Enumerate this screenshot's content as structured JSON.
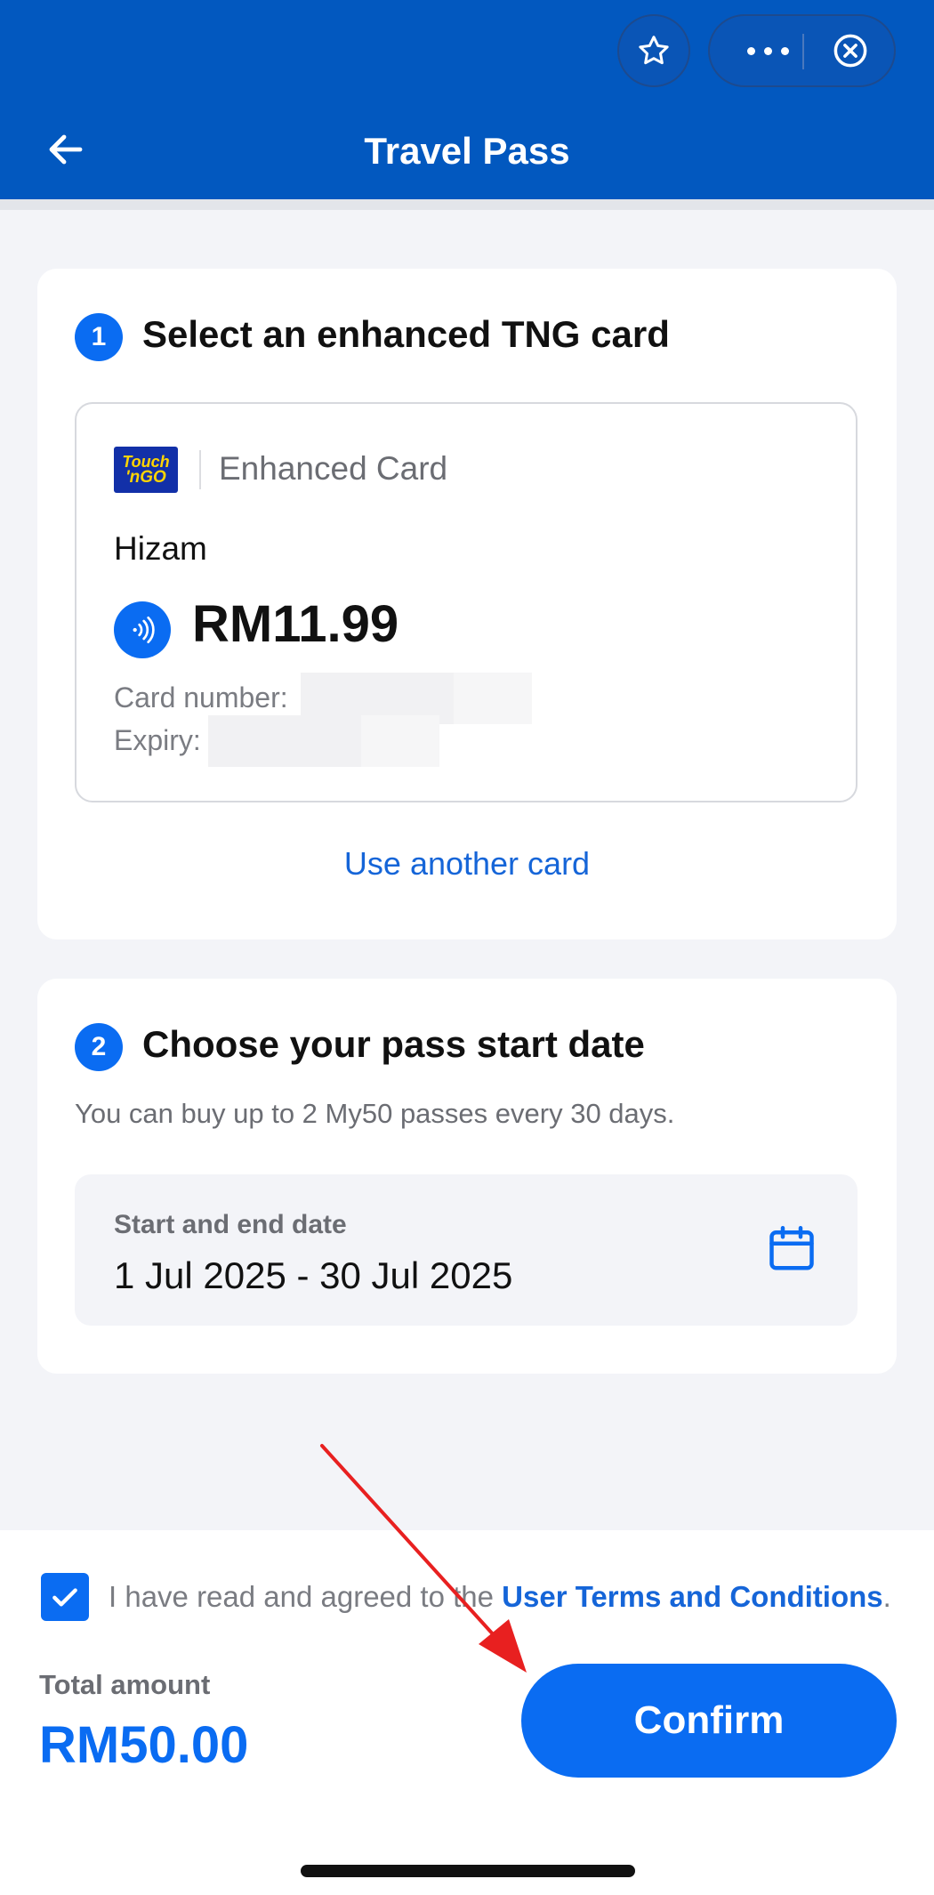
{
  "header": {
    "title": "Travel Pass",
    "icons": [
      "back-arrow-icon",
      "star-icon",
      "more-dots-icon",
      "close-circle-icon"
    ],
    "color": "#0258bf"
  },
  "step1": {
    "number": "1",
    "title": "Select an enhanced TNG card",
    "card": {
      "logo_line1": "Touch",
      "logo_line2": "'nGO",
      "type": "Enhanced Card",
      "name": "Hizam",
      "balance": "RM11.99",
      "card_number_label": "Card number:",
      "expiry_label": "Expiry:"
    },
    "use_another": "Use another card"
  },
  "step2": {
    "number": "2",
    "title": "Choose your pass start date",
    "limit_text": "You can buy up to 2 My50 passes every 30 days.",
    "date_label": "Start and end date",
    "date_value": "1 Jul 2025 - 30 Jul 2025"
  },
  "footer": {
    "agree_prefix": "I have read and agreed to the ",
    "agree_link": "User Terms and Conditions",
    "agree_suffix": ".",
    "agree_checked": true,
    "total_label": "Total amount",
    "total_value": "RM50.00",
    "confirm_label": "Confirm"
  },
  "colors": {
    "accent": "#0a6cf2",
    "link": "#1565d8",
    "annotation_arrow": "#e82020"
  }
}
